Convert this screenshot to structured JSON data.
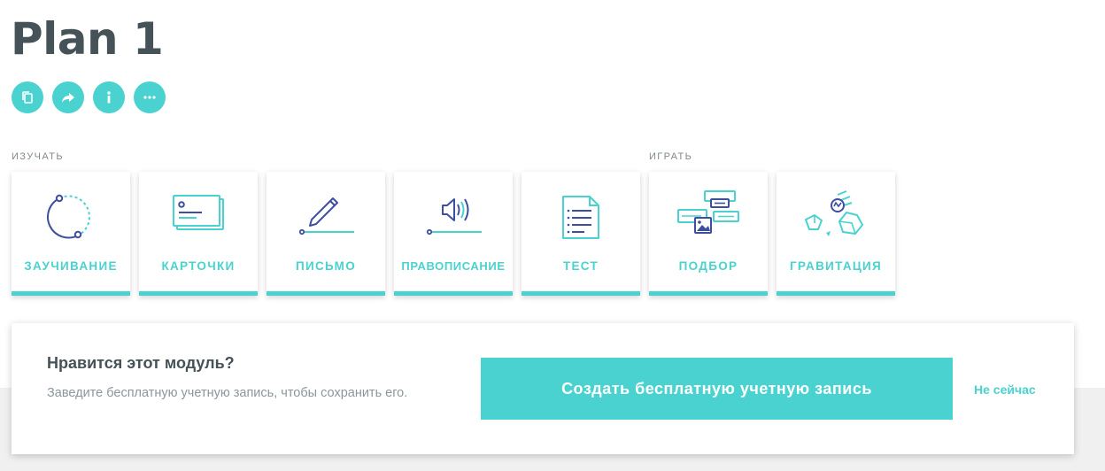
{
  "page": {
    "title": "Plan 1"
  },
  "actions": [
    {
      "name": "copy",
      "icon": "copy-icon"
    },
    {
      "name": "share",
      "icon": "share-icon"
    },
    {
      "name": "info",
      "icon": "info-icon"
    },
    {
      "name": "more",
      "icon": "more-icon"
    }
  ],
  "sections": {
    "study_label": "ИЗУЧАТЬ",
    "play_label": "ИГРАТЬ"
  },
  "tiles": [
    {
      "label": "ЗАУЧИВАНИЕ",
      "icon": "learn-icon"
    },
    {
      "label": "КАРТОЧКИ",
      "icon": "flashcards-icon"
    },
    {
      "label": "ПИСЬМО",
      "icon": "write-icon"
    },
    {
      "label": "ПРАВОПИСАНИЕ",
      "icon": "spell-icon"
    },
    {
      "label": "ТЕСТ",
      "icon": "test-icon"
    },
    {
      "label": "ПОДБОР",
      "icon": "match-icon"
    },
    {
      "label": "ГРАВИТАЦИЯ",
      "icon": "gravity-icon"
    }
  ],
  "banner": {
    "heading": "Нравится этот модуль?",
    "text": "Заведите бесплатную учетную запись, чтобы сохранить его.",
    "create_label": "Создать бесплатную учетную запись",
    "not_now_label": "Не сейчас"
  },
  "colors": {
    "accent": "#4ad2d0",
    "title": "#455358",
    "icon_dark": "#3f4f9f"
  }
}
